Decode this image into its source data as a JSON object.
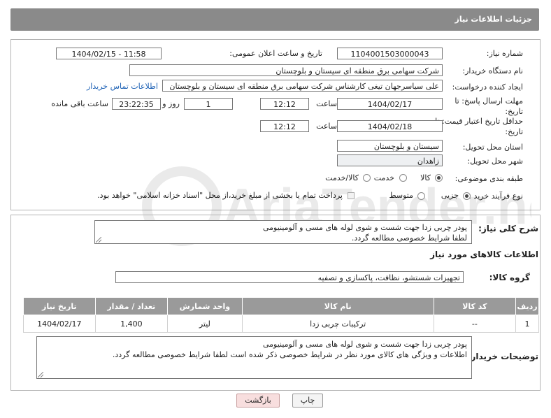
{
  "header": {
    "title": "جزئیات اطلاعات نیاز"
  },
  "fields": {
    "need_number_label": "شماره نیاز:",
    "need_number": "1104001503000043",
    "announce_label": "تاریخ و ساعت اعلان عمومی:",
    "announce_value": "1404/02/15 - 11:58",
    "buyer_org_label": "نام دستگاه خریدار:",
    "buyer_org": "شرکت سهامی برق منطقه ای سیستان و بلوچستان",
    "creator_label": "ایجاد کننده درخواست:",
    "creator": "علی سیاسرجهان تیغی کارشناس شرکت سهامی برق منطقه ای سیستان و بلوچستان",
    "contact_link": "اطلاعات تماس خریدار",
    "deadline_label": "مهلت ارسال پاسخ: تا تاریخ:",
    "deadline_date": "1404/02/17",
    "time_label": "ساعت",
    "deadline_time": "12:12",
    "days_value": "1",
    "days_label": "روز و",
    "remaining_time": "23:22:35",
    "remaining_label": "ساعت باقی مانده",
    "price_validity_label": "حداقل تاریخ اعتبار قیمت: تا تاریخ:",
    "price_validity_date": "1404/02/18",
    "price_validity_time": "12:12",
    "delivery_province_label": "استان محل تحویل:",
    "delivery_province": "سیستان و بلوچستان",
    "delivery_city_label": "شهر محل تحویل:",
    "delivery_city": "زاهدان",
    "category_label": "طبقه بندی موضوعی:",
    "category_options": [
      "کالا",
      "خدمت",
      "کالا/خدمت"
    ],
    "category_selected": "کالا",
    "process_label": "نوع فرآیند خرید :",
    "process_options": [
      "جزیی",
      "متوسط"
    ],
    "process_selected": "جزیی",
    "payment_note": "پرداخت تمام یا بخشی از مبلغ خرید،از محل \"اسناد خزانه اسلامی\" خواهد بود."
  },
  "description": {
    "label": "شرح کلی نیاز:",
    "lines": [
      "پودر چربی زدا جهت شست و شوی لوله های مسی و آلومینیومی",
      "لطفا شرایط خصوصی مطالعه گردد."
    ]
  },
  "goods": {
    "section_title": "اطلاعات کالاهای مورد نیاز",
    "group_label": "گروه کالا:",
    "group_value": "تجهیزات شستشو، نظافت، پاکسازی و تصفیه",
    "columns": [
      "ردیف",
      "کد کالا",
      "نام کالا",
      "واحد شمارش",
      "تعداد / مقدار",
      "تاریخ نیاز"
    ],
    "rows": [
      [
        "1",
        "--",
        "ترکیبات چربی زدا",
        "لیتر",
        "1,400",
        "1404/02/17"
      ]
    ]
  },
  "buyer_notes": {
    "label": "توضیحات خریدار:",
    "lines": [
      "پودر چربی زدا جهت شست و شوی لوله های مسی و آلومینیومی",
      "اطلاعات و ویژگی های کالای مورد نظر در شرایط خصوصی ذکر شده است لطفا شرایط خصوصی مطالعه گردد."
    ]
  },
  "buttons": {
    "print": "چاپ",
    "back": "بازگشت"
  },
  "watermark": {
    "text": "AriaTender.neT",
    "icon": "aria-logo-icon"
  },
  "colors": {
    "header_bg": "#8a8a8a",
    "link": "#1a5fb4",
    "back_button": "#f8dede"
  }
}
